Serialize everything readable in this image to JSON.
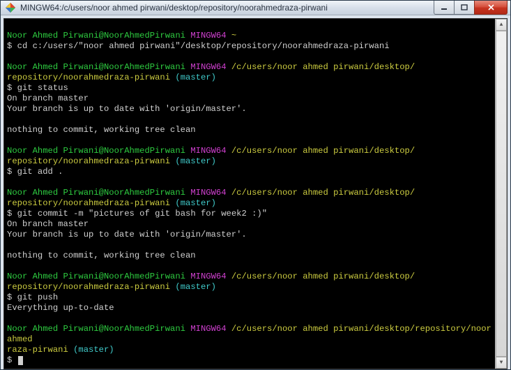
{
  "titlebar": {
    "title": "MINGW64:/c/users/noor ahmed pirwani/desktop/repository/noorahmedraza-pirwani"
  },
  "prompt": {
    "user_host": "Noor Ahmed Pirwani@NoorAhmedPirwani",
    "sys": "MINGW64",
    "home_tilde": "~",
    "path_full": "/c/users/noor ahmed pirwani/desktop/repository/noorahmedraza-pirwani",
    "path_line1": "/c/users/noor ahmed pirwani/desktop/",
    "path_line2": "repository/noorahmedraza-pirwani",
    "path_wrap_end": "/c/users/noor ahmed pirwani/desktop/repository/noorahmed",
    "path_wrap_cont": "raza-pirwani",
    "branch": "(master)",
    "ps1": "$"
  },
  "cmds": {
    "cd": "cd c:/users/\"noor ahmed pirwani\"/desktop/repository/noorahmedraza-pirwani",
    "status": "git status",
    "add": "git add .",
    "commit": "git commit -m \"pictures of git bash for week2 :)\"",
    "push": "git push"
  },
  "out": {
    "on_branch": "On branch master",
    "uptodate": "Your branch is up to date with 'origin/master'.",
    "nothing": "nothing to commit, working tree clean",
    "everything": "Everything up-to-date"
  }
}
